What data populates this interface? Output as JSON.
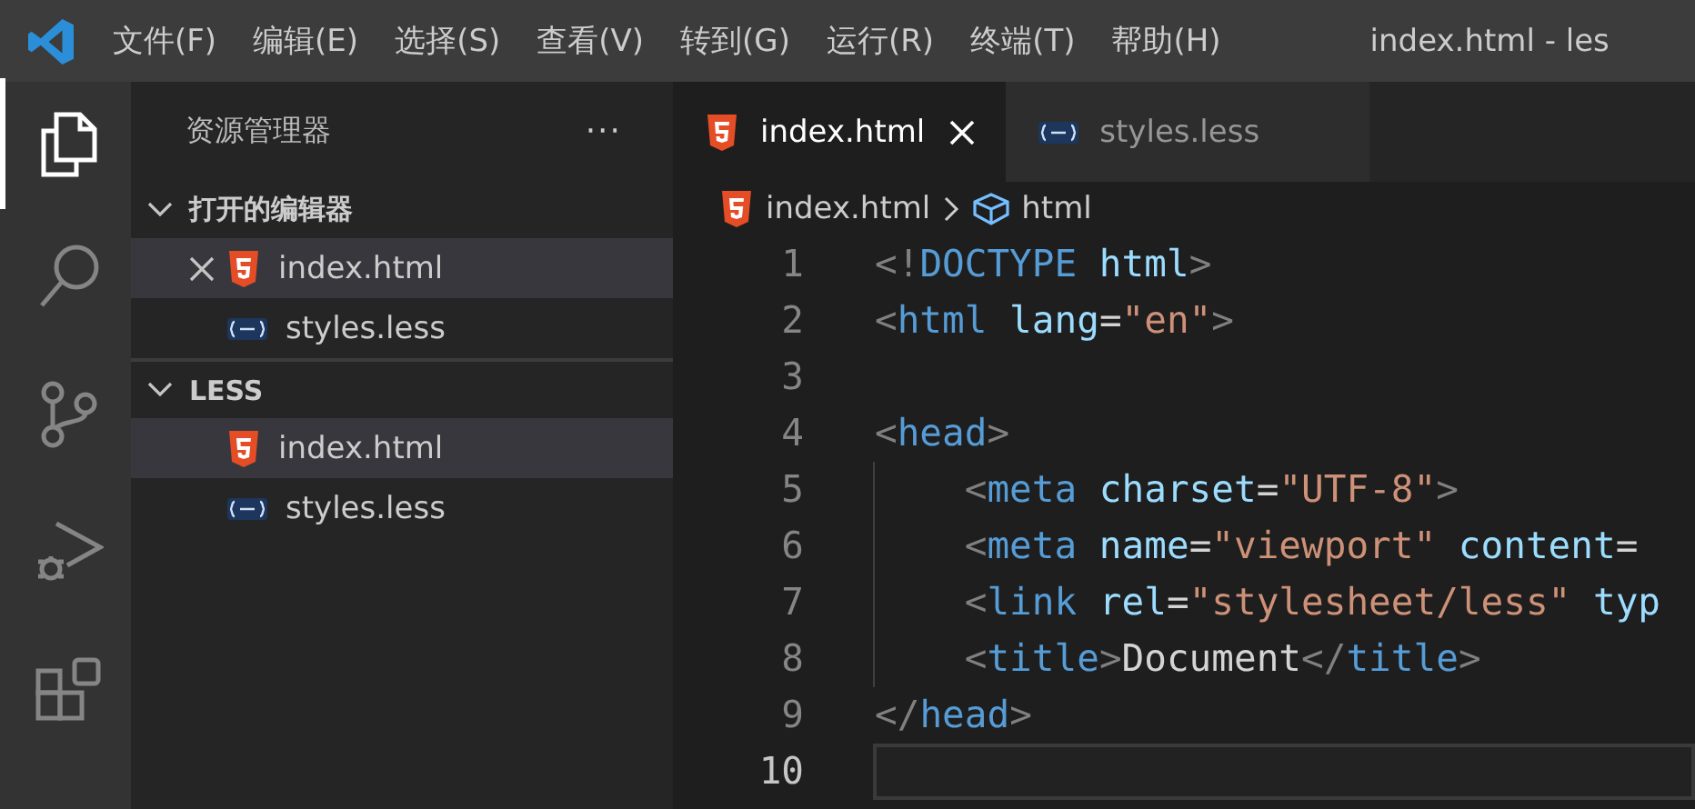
{
  "title_bar": {
    "menu": [
      "文件(F)",
      "编辑(E)",
      "选择(S)",
      "查看(V)",
      "转到(G)",
      "运行(R)",
      "终端(T)",
      "帮助(H)"
    ],
    "title": "index.html - les"
  },
  "activity_bar": [
    {
      "kind": "explorer",
      "selected": true
    },
    {
      "kind": "search",
      "selected": false
    },
    {
      "kind": "source-control",
      "selected": false
    },
    {
      "kind": "run",
      "selected": false
    },
    {
      "kind": "extensions",
      "selected": false
    }
  ],
  "sidebar": {
    "title": "资源管理器",
    "more": "···",
    "sections": [
      {
        "title": "打开的编辑器",
        "expanded": true,
        "items": [
          {
            "name": "index.html",
            "kind": "html",
            "selected": true,
            "close_button": true
          },
          {
            "name": "styles.less",
            "kind": "less",
            "selected": false,
            "close_button": false
          }
        ]
      },
      {
        "title": "LESS",
        "expanded": true,
        "items": [
          {
            "name": "index.html",
            "kind": "html",
            "selected": true,
            "close_button": false
          },
          {
            "name": "styles.less",
            "kind": "less",
            "selected": false,
            "close_button": false
          }
        ]
      }
    ]
  },
  "tabs": [
    {
      "label": "index.html",
      "kind": "html",
      "selected": true
    },
    {
      "label": "styles.less",
      "kind": "less",
      "selected": false
    }
  ],
  "breadcrumb": [
    "index.html",
    "html"
  ],
  "editor": {
    "lines": [
      {
        "number": "1",
        "indent_guide": false,
        "current_line": false,
        "tokens": [
          {
            "kind": "punct",
            "text": "<!"
          },
          {
            "kind": "tag",
            "text": "DOCTYPE"
          },
          {
            "kind": "attr",
            "text": " html"
          },
          {
            "kind": "punct",
            "text": ">"
          }
        ]
      },
      {
        "number": "2",
        "indent_guide": false,
        "current_line": false,
        "tokens": [
          {
            "kind": "punct",
            "text": "<"
          },
          {
            "kind": "tag",
            "text": "html"
          },
          {
            "kind": "attr",
            "text": " lang"
          },
          {
            "kind": "text",
            "text": "="
          },
          {
            "kind": "str",
            "text": "\"en\""
          },
          {
            "kind": "punct",
            "text": ">"
          }
        ]
      },
      {
        "number": "3",
        "indent_guide": false,
        "current_line": false
      },
      {
        "number": "4",
        "indent_guide": false,
        "current_line": false,
        "tokens": [
          {
            "kind": "punct",
            "text": "<"
          },
          {
            "kind": "tag",
            "text": "head"
          },
          {
            "kind": "punct",
            "text": ">"
          }
        ]
      },
      {
        "number": "5",
        "indent_guide": true,
        "current_line": false,
        "tokens": [
          {
            "kind": "punct",
            "text": "    <"
          },
          {
            "kind": "tag",
            "text": "meta"
          },
          {
            "kind": "attr",
            "text": " charset"
          },
          {
            "kind": "text",
            "text": "="
          },
          {
            "kind": "str",
            "text": "\"UTF-8\""
          },
          {
            "kind": "punct",
            "text": ">"
          }
        ]
      },
      {
        "number": "6",
        "indent_guide": true,
        "current_line": false,
        "tokens": [
          {
            "kind": "punct",
            "text": "    <"
          },
          {
            "kind": "tag",
            "text": "meta"
          },
          {
            "kind": "attr",
            "text": " name"
          },
          {
            "kind": "text",
            "text": "="
          },
          {
            "kind": "str",
            "text": "\"viewport\""
          },
          {
            "kind": "attr",
            "text": " content"
          },
          {
            "kind": "text",
            "text": "="
          }
        ]
      },
      {
        "number": "7",
        "indent_guide": true,
        "current_line": false,
        "tokens": [
          {
            "kind": "punct",
            "text": "    <"
          },
          {
            "kind": "tag",
            "text": "link"
          },
          {
            "kind": "attr",
            "text": " rel"
          },
          {
            "kind": "text",
            "text": "="
          },
          {
            "kind": "str",
            "text": "\"stylesheet/less\""
          },
          {
            "kind": "attr",
            "text": " typ"
          }
        ]
      },
      {
        "number": "8",
        "indent_guide": true,
        "current_line": false,
        "tokens": [
          {
            "kind": "punct",
            "text": "    <"
          },
          {
            "kind": "tag",
            "text": "title"
          },
          {
            "kind": "punct",
            "text": ">"
          },
          {
            "kind": "text",
            "text": "Document"
          },
          {
            "kind": "punct",
            "text": "</"
          },
          {
            "kind": "tag",
            "text": "title"
          },
          {
            "kind": "punct",
            "text": ">"
          }
        ]
      },
      {
        "number": "9",
        "indent_guide": false,
        "current_line": false,
        "tokens": [
          {
            "kind": "punct",
            "text": "</"
          },
          {
            "kind": "tag",
            "text": "head"
          },
          {
            "kind": "punct",
            "text": ">"
          }
        ]
      },
      {
        "number": "10",
        "indent_guide": false,
        "current_line": true
      }
    ]
  }
}
